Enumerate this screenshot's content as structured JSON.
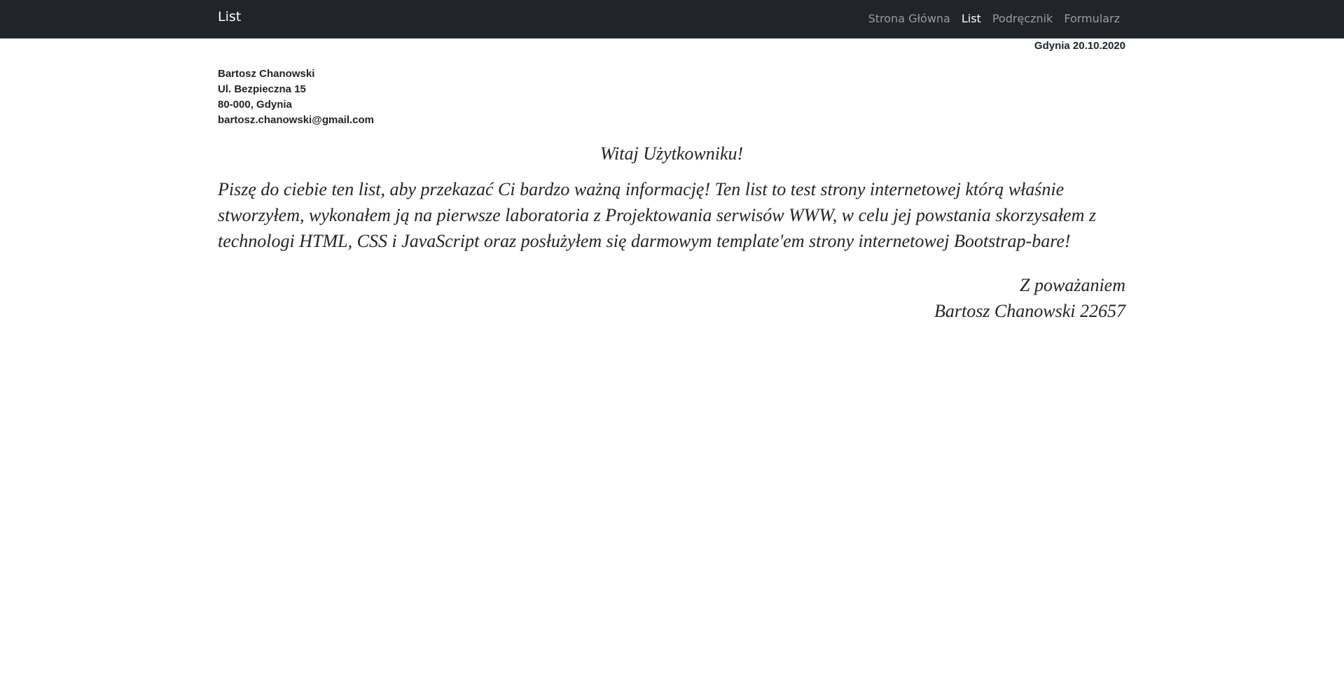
{
  "navbar": {
    "brand": "List",
    "links": [
      {
        "label": "Strona Główna",
        "active": false
      },
      {
        "label": "List",
        "active": true
      },
      {
        "label": "Podręcznik",
        "active": false
      },
      {
        "label": "Formularz",
        "active": false
      }
    ]
  },
  "letter": {
    "date": "Gdynia 20.10.2020",
    "sender": {
      "name": "Bartosz Chanowski",
      "street": "Ul. Bezpieczna 15",
      "city": "80-000, Gdynia",
      "email": "bartosz.chanowski@gmail.com"
    },
    "greeting": "Witaj Użytkowniku!",
    "body": "Piszę do ciebie ten list, aby przekazać Ci bardzo ważną informację! Ten list to test strony internetowej którą właśnie stworzyłem, wykonałem ją na pierwsze laboratoria z Projektowania serwisów WWW, w celu jej powstania skorzysałem z technologi HTML, CSS i JavaScript oraz posłużyłem się darmowym template'em strony internetowej Bootstrap-bare!",
    "closing": "Z poważaniem",
    "signature": "Bartosz Chanowski 22657"
  },
  "colors": {
    "navbar_bg": "#212529",
    "nav_link": "#9a9da0",
    "nav_link_active": "#ffffff",
    "text": "#212529"
  }
}
